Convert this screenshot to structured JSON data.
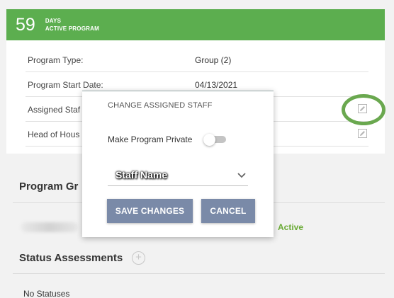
{
  "header": {
    "days_count": "59",
    "days_label": "DAYS",
    "program_label": "ACTIVE PROGRAM",
    "color": "#5cae4f"
  },
  "program_details": {
    "rows": [
      {
        "label": "Program Type:",
        "value": "Group (2)"
      },
      {
        "label": "Program Start Date:",
        "value": "04/13/2021"
      },
      {
        "label": "Assigned Staf",
        "value": ""
      },
      {
        "label": "Head of Hous",
        "value": ""
      }
    ],
    "edit_icon": "edit-icon"
  },
  "sections": {
    "program_group_title": "Program Gr",
    "group_status": "Active",
    "status_title": "Status Assessments",
    "no_statuses": "No Statuses"
  },
  "modal": {
    "title": "CHANGE ASSIGNED STAFF",
    "private_label": "Make Program Private",
    "private_enabled": false,
    "staff_select_value": "Staff Name",
    "save_label": "SAVE CHANGES",
    "cancel_label": "CANCEL",
    "button_color": "#7a8aa8"
  },
  "colors": {
    "active_text": "#6aaa35",
    "highlight_circle": "#6aa84f"
  }
}
